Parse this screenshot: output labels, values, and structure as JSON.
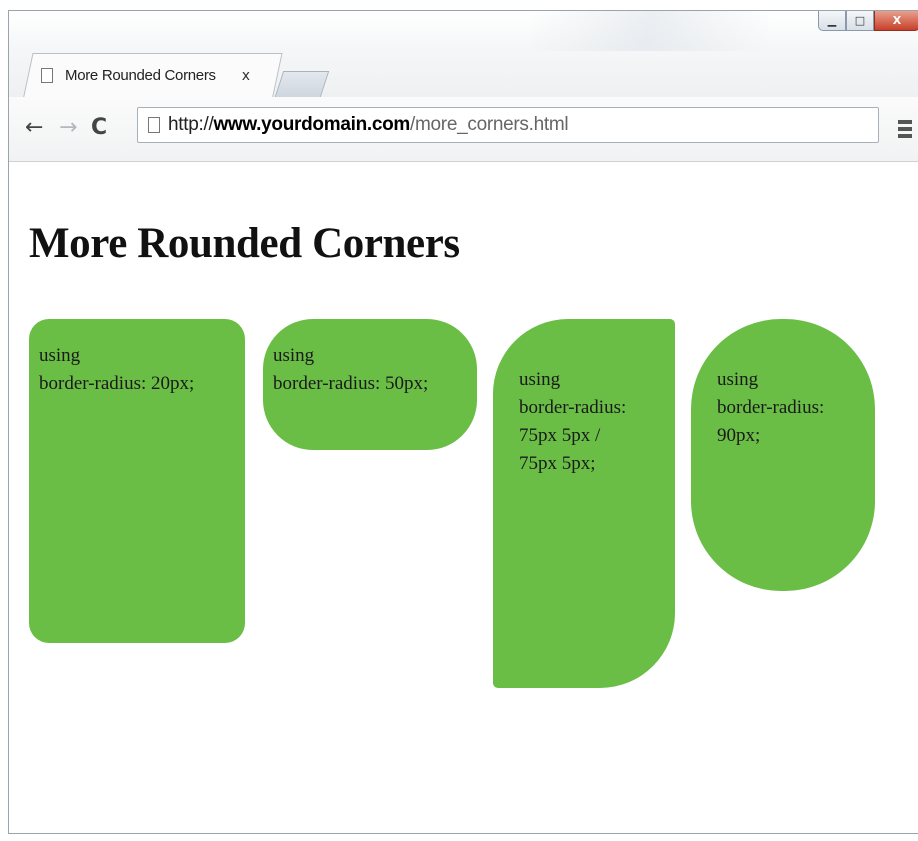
{
  "window": {
    "controls": {
      "minimize": "▁",
      "maximize": "□",
      "close": "X"
    }
  },
  "tab": {
    "title": "More Rounded Corners",
    "close": "x"
  },
  "toolbar": {
    "back": "←",
    "forward": "→",
    "reload": "C",
    "url": {
      "scheme": "http://",
      "host": "www.yourdomain.com",
      "path": "/more_corners.html"
    }
  },
  "page": {
    "heading": "More Rounded Corners",
    "boxes": [
      {
        "line1": "using",
        "line2": "border-radius: 20px;"
      },
      {
        "line1": "using",
        "line2": "border-radius: 50px;"
      },
      {
        "line1": "using",
        "line2": "border-radius:",
        "line3": "75px 5px /",
        "line4": "75px 5px;"
      },
      {
        "line1": "using",
        "line2": "border-radius:",
        "line3": "90px;"
      }
    ],
    "box_color": "#6abd45"
  }
}
